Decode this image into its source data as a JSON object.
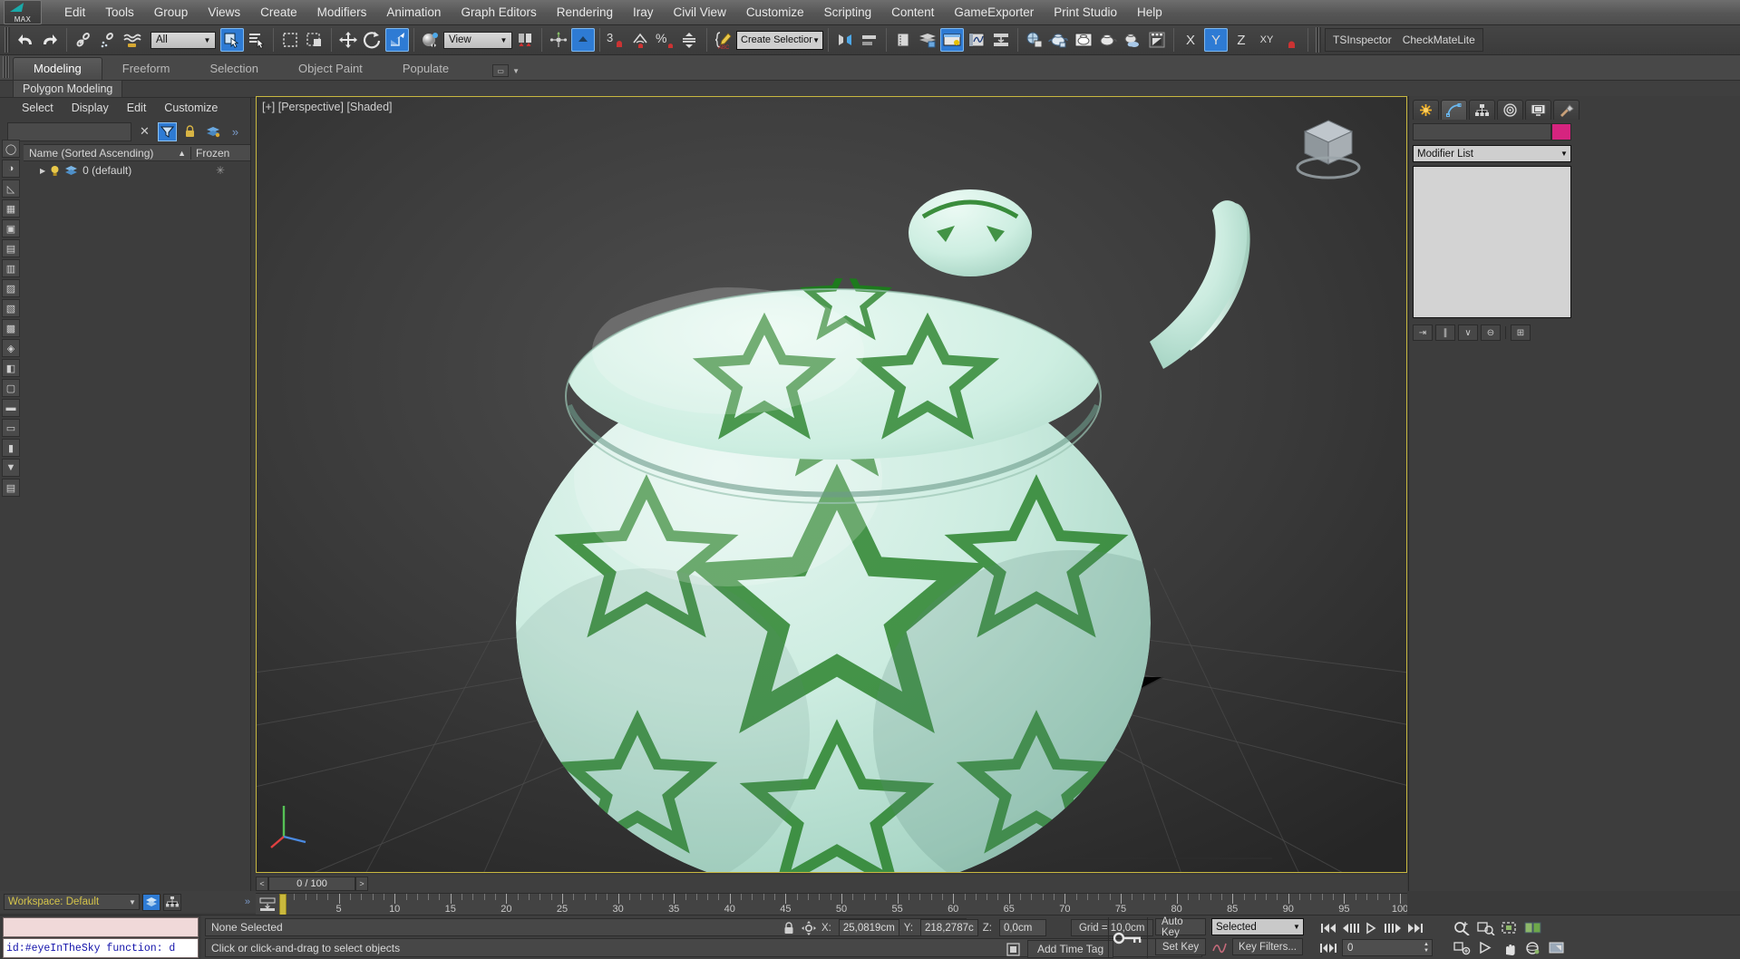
{
  "app": {
    "logo_label": "MAX"
  },
  "menu": {
    "items": [
      "Edit",
      "Tools",
      "Group",
      "Views",
      "Create",
      "Modifiers",
      "Animation",
      "Graph Editors",
      "Rendering",
      "Iray",
      "Civil View",
      "Customize",
      "Scripting",
      "Content",
      "GameExporter",
      "Print Studio",
      "Help"
    ]
  },
  "toolbar": {
    "selection_filter": "All",
    "reference_coord": "View",
    "named_selection_sets": "Create Selection Se",
    "plugins": [
      "TSInspector",
      "CheckMateLite"
    ],
    "axis_constraints": [
      "X",
      "Y",
      "Z",
      "XY"
    ],
    "active_axis": "Y",
    "icons": [
      "undo-icon",
      "redo-icon",
      "select-link-icon",
      "unlink-icon",
      "bind-space-warp-icon",
      "select-object-icon",
      "select-by-name-icon",
      "rectangular-region-icon",
      "window-crossing-icon",
      "select-move-icon",
      "select-rotate-icon",
      "select-scale-icon",
      "ref-coord-icon",
      "use-pivot-icon",
      "use-center-icon",
      "snap-toggle-icon",
      "snap3-icon",
      "angle-snap-icon",
      "percent-snap-icon",
      "spinner-snap-icon",
      "edit-named-sets-icon",
      "mirror-icon",
      "align-icon",
      "layer-manager-icon",
      "ribbon-icon",
      "curve-editor-icon",
      "schematic-view-icon",
      "material-editor-icon",
      "render-setup-icon",
      "rendered-frame-icon",
      "render-production-icon",
      "render-iterative-icon",
      "render-in-cloud-icon"
    ]
  },
  "ribbon": {
    "tabs": [
      "Modeling",
      "Freeform",
      "Selection",
      "Object Paint",
      "Populate"
    ],
    "active_tab": "Modeling",
    "subtab": "Polygon Modeling"
  },
  "scene_explorer": {
    "menu": [
      "Select",
      "Display",
      "Edit",
      "Customize"
    ],
    "search_value": "",
    "columns": [
      "Name (Sorted Ascending)",
      "Frozen"
    ],
    "sort_indicator": "▲",
    "rows": [
      {
        "name": "0 (default)",
        "frozen": "",
        "expander": "▶"
      }
    ],
    "more_label": "»"
  },
  "viewport": {
    "label": "[+] [Perspective] [Shaded]",
    "view_type": "Perspective",
    "shading": "Shaded",
    "border_color": "#c8b840",
    "object": "teapot",
    "object_body_color": "#cdece1",
    "object_pattern_color": "#1d7a1d"
  },
  "command_panel": {
    "tabs": [
      "create-tab",
      "modify-tab",
      "hierarchy-tab",
      "motion-tab",
      "display-tab",
      "utilities-tab"
    ],
    "active_tab": "modify-tab",
    "object_name": "",
    "object_color": "#d6247f",
    "modifier_list_label": "Modifier List",
    "stack_tools": [
      "pin-stack-icon",
      "show-end-result-icon",
      "make-unique-icon",
      "remove-modifier-icon",
      "configure-sets-icon"
    ]
  },
  "timeline": {
    "current_frame_label": "0 / 100",
    "prev_label": "<",
    "next_label": ">",
    "range_start": 0,
    "range_end": 100,
    "major_ticks": [
      0,
      5,
      10,
      15,
      20,
      25,
      30,
      35,
      40,
      45,
      50,
      55,
      60,
      65,
      70,
      75,
      80,
      85,
      90,
      95,
      100
    ],
    "slider_position": 0
  },
  "workspace": {
    "label": "Workspace: Default"
  },
  "maxscript": {
    "input_value": "",
    "output_value": "id:#eyeInTheSky   function: d"
  },
  "status": {
    "selection": "None Selected",
    "prompt": "Click or click-and-drag to select objects",
    "coords": {
      "x_label": "X:",
      "x_value": "25,0819cm",
      "y_label": "Y:",
      "y_value": "218,2787c",
      "z_label": "Z:",
      "z_value": "0,0cm"
    },
    "grid": "Grid = 10,0cm",
    "add_time_tag": "Add Time Tag"
  },
  "animation": {
    "auto_key": "Auto Key",
    "set_key": "Set Key",
    "key_mode": "Selected",
    "key_filters": "Key Filters...",
    "frame_value": "0",
    "transport": [
      "go-to-start-icon",
      "previous-frame-icon",
      "play-animation-icon",
      "next-frame-icon",
      "go-to-end-icon"
    ],
    "nav": [
      "zoom-icon",
      "zoom-all-icon",
      "zoom-extents-icon",
      "zoom-region-icon",
      "field-of-view-icon",
      "pan-view-icon",
      "orbit-icon",
      "maximize-viewport-icon"
    ]
  }
}
